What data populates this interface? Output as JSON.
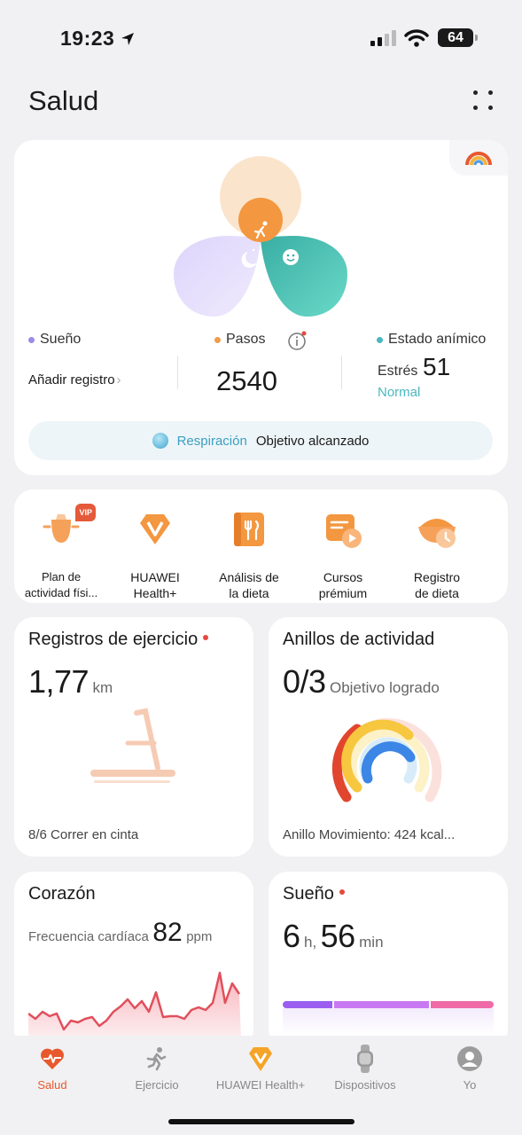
{
  "status_bar": {
    "time": "19:23",
    "battery": "64"
  },
  "header": {
    "title": "Salud"
  },
  "summary": {
    "sleep": {
      "label": "Sueño",
      "action": "Añadir registro",
      "color": "#9b8ae8"
    },
    "steps": {
      "label": "Pasos",
      "value": "2540",
      "color": "#f09a4c"
    },
    "mood": {
      "label": "Estado anímico",
      "stress_label": "Estrés",
      "stress_value": "51",
      "stress_state": "Normal",
      "color": "#4cb7be"
    },
    "breath": {
      "label": "Respiración",
      "status": "Objetivo alcanzado"
    }
  },
  "shortcuts": [
    {
      "label": "Plan de actividad físi...",
      "badge": "VIP"
    },
    {
      "label": "HUAWEI Health+"
    },
    {
      "label": "Análisis de la dieta"
    },
    {
      "label": "Cursos prémium"
    },
    {
      "label": "Registro de dieta"
    }
  ],
  "exercise": {
    "title": "Registros de ejercicio",
    "value": "1,77",
    "unit": "km",
    "footer": "8/6 Correr en cinta"
  },
  "rings": {
    "title": "Anillos de actividad",
    "value": "0/3",
    "subtitle": "Objetivo logrado",
    "footer": "Anillo Movimiento: 424 kcal..."
  },
  "heart": {
    "title": "Corazón",
    "label": "Frecuencia cardíaca",
    "value": "82",
    "unit": "ppm",
    "color": "#e0505c"
  },
  "sleep_card": {
    "title": "Sueño",
    "hours": "6",
    "h_unit": "h,",
    "minutes": "56",
    "m_unit": "min"
  },
  "tabs": [
    {
      "label": "Salud",
      "active": true
    },
    {
      "label": "Ejercicio"
    },
    {
      "label": "HUAWEI Health+"
    },
    {
      "label": "Dispositivos"
    },
    {
      "label": "Yo"
    }
  ],
  "accent": "#e8592d"
}
